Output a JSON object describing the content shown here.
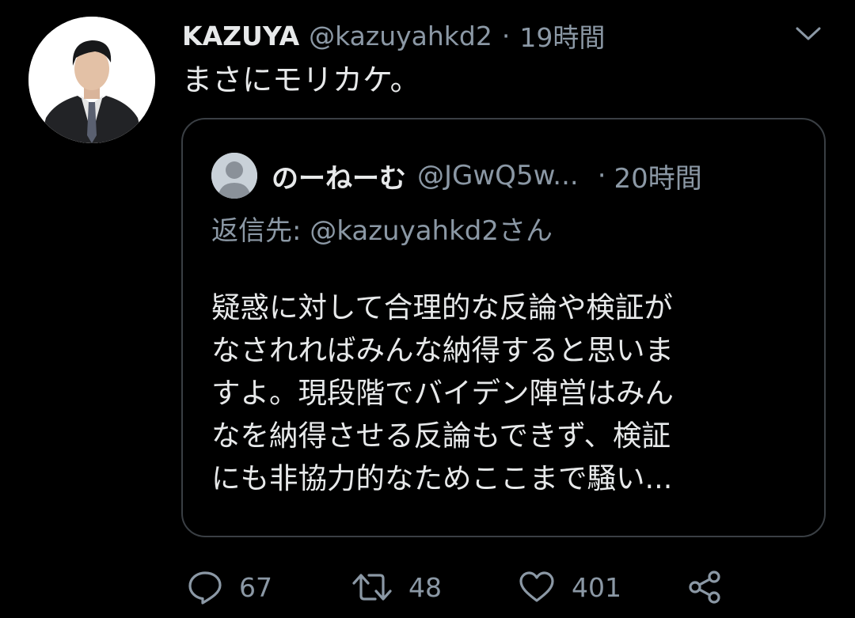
{
  "tweet": {
    "author_name": "KAZUYA",
    "author_handle": "@kazuyahkd2",
    "separator": "·",
    "time": "19時間",
    "text": "まさにモリカケ。"
  },
  "quoted_tweet": {
    "author_name": "のーねーむ",
    "author_handle": "@JGwQ5w...",
    "separator": "·",
    "time": "20時間",
    "reply_to": "返信先: @kazuyahkd2さん",
    "text": "疑惑に対して合理的な反論や検証が\nなされればみんな納得すると思いま\nすよ。現段階でバイデン陣営はみん\nなを納得させる反論もできず、検証\nにも非協力的なためここまで騒い..."
  },
  "actions": {
    "reply_count": "67",
    "retweet_count": "48",
    "like_count": "401"
  },
  "icons": {
    "menu": "chevron-down-icon",
    "reply": "reply-icon",
    "retweet": "retweet-icon",
    "like": "heart-icon",
    "share": "share-icon"
  },
  "colors": {
    "background": "#000000",
    "text_primary": "#e7e9ea",
    "text_secondary": "#8b98a5",
    "quote_border": "#3a3f44"
  }
}
